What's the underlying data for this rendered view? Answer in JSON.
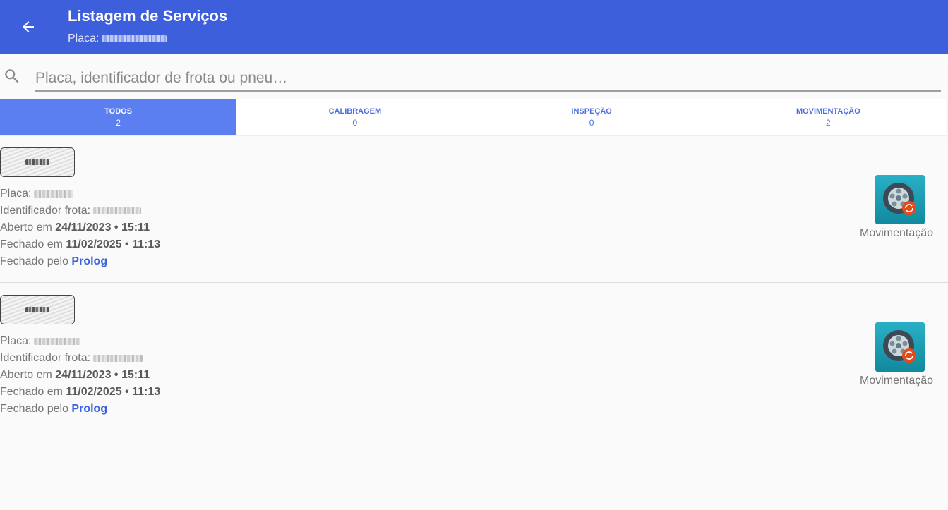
{
  "header": {
    "title": "Listagem de Serviços",
    "subtitle_label": "Placa:"
  },
  "search": {
    "placeholder": "Placa, identificador de frota ou pneu…"
  },
  "tabs": [
    {
      "label": "TODOS",
      "count": "2"
    },
    {
      "label": "CALIBRAGEM",
      "count": "0"
    },
    {
      "label": "INSPEÇÃO",
      "count": "0"
    },
    {
      "label": "MOVIMENTAÇÃO",
      "count": "2"
    }
  ],
  "items": [
    {
      "placa_label": "Placa:",
      "frota_label": "Identificador frota:",
      "aberto_label": "Aberto em",
      "aberto_value": "24/11/2023 • 15:11",
      "fechado_label": "Fechado em",
      "fechado_value": "11/02/2025 • 11:13",
      "fechado_pelo_label": "Fechado pelo",
      "fechado_pelo_value": "Prolog",
      "type_label": "Movimentação"
    },
    {
      "placa_label": "Placa:",
      "frota_label": "Identificador frota:",
      "aberto_label": "Aberto em",
      "aberto_value": "24/11/2023 • 15:11",
      "fechado_label": "Fechado em",
      "fechado_value": "11/02/2025 • 11:13",
      "fechado_pelo_label": "Fechado pelo",
      "fechado_pelo_value": "Prolog",
      "type_label": "Movimentação"
    }
  ],
  "icons": {
    "back": "arrow-left-icon",
    "search": "search-icon",
    "movimentacao": "tire-rotate-icon"
  },
  "colors": {
    "appbar": "#3d5fdb",
    "tab_active": "#5b7ff0",
    "accent": "#3d63dd",
    "movimentacao_icon": "#1aa0b6"
  }
}
